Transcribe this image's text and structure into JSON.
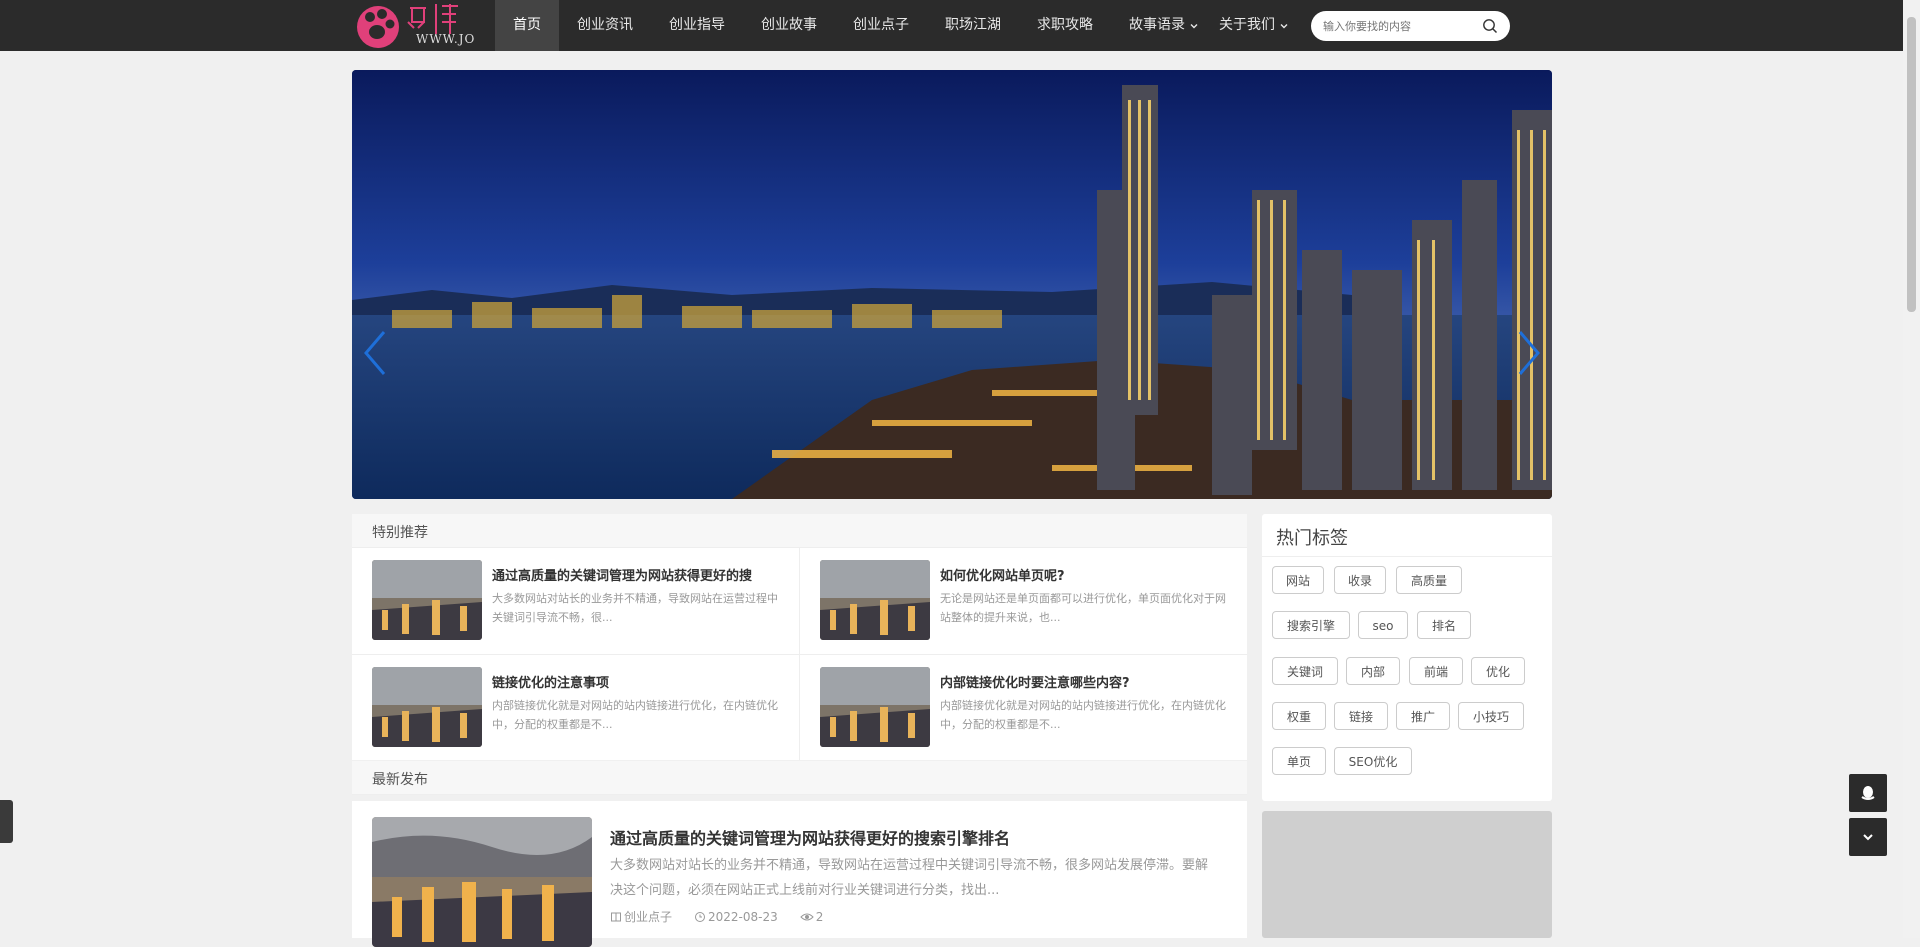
{
  "header": {
    "logo_text": "WWW.JO",
    "nav": [
      {
        "label": "首页",
        "active": true
      },
      {
        "label": "创业资讯"
      },
      {
        "label": "创业指导"
      },
      {
        "label": "创业故事"
      },
      {
        "label": "创业点子"
      },
      {
        "label": "职场江湖"
      },
      {
        "label": "求职攻略"
      },
      {
        "label": "故事语录",
        "dropdown": true
      },
      {
        "label": "关于我们",
        "dropdown": true
      }
    ],
    "search_placeholder": "输入你要找的内容"
  },
  "recommend": {
    "title": "特别推荐",
    "items": [
      {
        "title": "通过高质量的关键词管理为网站获得更好的搜",
        "desc": "大多数网站对站长的业务并不精通，导致网站在运营过程中关键词引导流不畅，很..."
      },
      {
        "title": "如何优化网站单页呢?",
        "desc": "无论是网站还是单页面都可以进行优化，单页面优化对于网站整体的提升来说，也..."
      },
      {
        "title": "链接优化的注意事项",
        "desc": "内部链接优化就是对网站的站内链接进行优化，在内链优化中，分配的权重都是不..."
      },
      {
        "title": "内部链接优化时要注意哪些内容?",
        "desc": "内部链接优化就是对网站的站内链接进行优化，在内链优化中，分配的权重都是不..."
      }
    ]
  },
  "latest": {
    "title": "最新发布",
    "posts": [
      {
        "title": "通过高质量的关键词管理为网站获得更好的搜索引擎排名",
        "desc": "大多数网站对站长的业务并不精通，导致网站在运营过程中关键词引导流不畅，很多网站发展停滞。要解决这个问题，必须在网站正式上线前对行业关键词进行分类，找出...",
        "category": "创业点子",
        "date": "2022-08-23",
        "views": "2"
      }
    ]
  },
  "sidebar": {
    "tags_title": "热门标签",
    "tags": [
      "网站",
      "收录",
      "高质量",
      "搜索引擎",
      "seo",
      "排名",
      "关键词",
      "内部",
      "前端",
      "优化",
      "权重",
      "链接",
      "推广",
      "小技巧",
      "单页",
      "SEO优化"
    ]
  },
  "colors": {
    "topbar": "#2b2b2b",
    "active_nav": "#444444",
    "arrow": "#1e6fd9",
    "logo_pink": "#e0407a"
  }
}
